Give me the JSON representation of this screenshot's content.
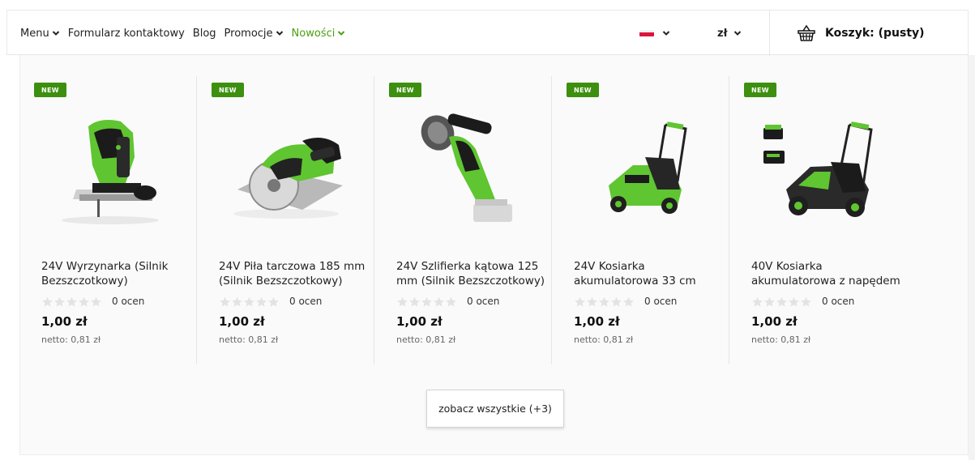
{
  "nav": {
    "items": [
      {
        "label": "Menu",
        "dropdown": true
      },
      {
        "label": "Formularz kontaktowy",
        "dropdown": false
      },
      {
        "label": "Blog",
        "dropdown": false
      },
      {
        "label": "Promocje",
        "dropdown": true
      },
      {
        "label": "Nowości",
        "dropdown": true,
        "color": "#4b9f12"
      }
    ]
  },
  "language": {
    "flag": "pl-flag-icon"
  },
  "currency": {
    "label": "zł"
  },
  "cart": {
    "icon": "basket-icon",
    "label": "Koszyk: (pusty)"
  },
  "colors": {
    "badge": "#3d8f10",
    "accent": "#4b9f12",
    "tool_green": "#5fc531",
    "tool_dark": "#1b1b1b"
  },
  "products": [
    {
      "badge": "NEW",
      "name": "24V Wyrzynarka (Silnik Bezszczotkowy)",
      "rating_count": "0 ocen",
      "stars": 0,
      "price": "1,00 zł",
      "netto": "netto: 0,81 zł",
      "image": "jigsaw-image"
    },
    {
      "badge": "NEW",
      "name": "24V Piła tarczowa 185 mm (Silnik Bezszczotkowy)",
      "rating_count": "0 ocen",
      "stars": 0,
      "price": "1,00 zł",
      "netto": "netto: 0,81 zł",
      "image": "circular-saw-image"
    },
    {
      "badge": "NEW",
      "name": "24V Szlifierka kątowa 125 mm (Silnik Bezszczotkowy)",
      "rating_count": "0 ocen",
      "stars": 0,
      "price": "1,00 zł",
      "netto": "netto: 0,81 zł",
      "image": "angle-grinder-image"
    },
    {
      "badge": "NEW",
      "name": "24V Kosiarka akumulatorowa 33 cm",
      "rating_count": "0 ocen",
      "stars": 0,
      "price": "1,00 zł",
      "netto": "netto: 0,81 zł",
      "image": "lawn-mower-image"
    },
    {
      "badge": "NEW",
      "name": "40V Kosiarka akumulatorowa z napędem",
      "rating_count": "0 ocen",
      "stars": 0,
      "price": "1,00 zł",
      "netto": "netto: 0,81 zł",
      "image": "self-propelled-mower-image"
    }
  ],
  "see_all": {
    "label": "zobacz wszystkie (+3)"
  }
}
